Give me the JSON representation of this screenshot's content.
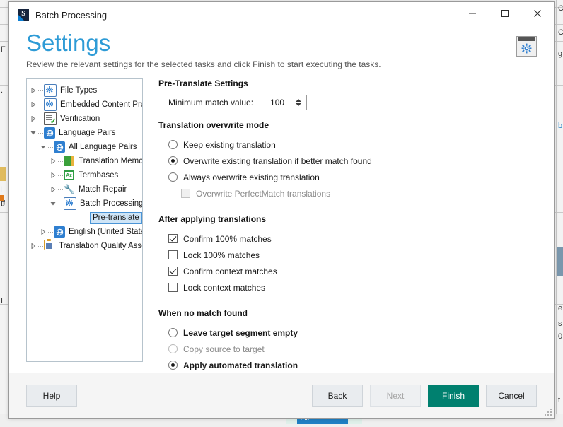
{
  "window": {
    "title": "Batch Processing",
    "app_icon": "trados-studio-icon",
    "icon_letter": "S",
    "minimize_label": "Minimize",
    "maximize_label": "Maximize",
    "close_label": "Close"
  },
  "header": {
    "title": "Settings",
    "subtitle": "Review the relevant settings for the selected tasks and click Finish to start executing the tasks.",
    "title_color": "#2e9bd6",
    "gear_button": "settings-gear"
  },
  "tree": {
    "items": [
      {
        "label": "File Types",
        "icon": "gear-box-icon",
        "indent": 0,
        "expander": "collapsed",
        "selected": false
      },
      {
        "label": "Embedded Content Proc",
        "icon": "gear-box-icon",
        "indent": 0,
        "expander": "collapsed",
        "selected": false
      },
      {
        "label": "Verification",
        "icon": "verification-doc-icon",
        "indent": 0,
        "expander": "collapsed",
        "selected": false
      },
      {
        "label": "Language Pairs",
        "icon": "language-globe-icon",
        "indent": 0,
        "expander": "expanded",
        "selected": false
      },
      {
        "label": "All Language Pairs",
        "icon": "language-globe-icon",
        "indent": 1,
        "expander": "expanded",
        "selected": false
      },
      {
        "label": "Translation Memo",
        "icon": "translation-memory-icon",
        "indent": 2,
        "expander": "collapsed",
        "selected": false
      },
      {
        "label": "Termbases",
        "icon": "termbase-icon",
        "indent": 2,
        "expander": "collapsed",
        "selected": false
      },
      {
        "label": "Match Repair",
        "icon": "wrench-icon",
        "indent": 2,
        "expander": "collapsed",
        "selected": false
      },
      {
        "label": "Batch Processing",
        "icon": "gear-box-icon",
        "indent": 2,
        "expander": "expanded",
        "selected": false
      },
      {
        "label": "Pre-translate Files",
        "icon": "none",
        "indent": 3,
        "expander": "none",
        "selected": true
      },
      {
        "label": "English (United States",
        "icon": "language-globe-icon",
        "indent": 1,
        "expander": "collapsed",
        "selected": false
      },
      {
        "label": "Translation Quality Assess",
        "icon": "clipboard-icon",
        "indent": 0,
        "expander": "collapsed",
        "selected": false
      }
    ]
  },
  "settings": {
    "pre_translate": {
      "title": "Pre-Translate Settings",
      "min_match_label": "Minimum match value:",
      "min_match_value": "100"
    },
    "overwrite_mode": {
      "title": "Translation overwrite mode",
      "options": [
        {
          "label": "Keep existing translation",
          "selected": false
        },
        {
          "label": "Overwrite existing translation if better match found",
          "selected": true
        },
        {
          "label": "Always overwrite existing translation",
          "selected": false
        }
      ],
      "sub_checkbox": {
        "label": "Overwrite PerfectMatch translations",
        "checked": false,
        "disabled": true
      }
    },
    "after_applying": {
      "title": "After applying translations",
      "checkboxes": [
        {
          "label": "Confirm 100% matches",
          "checked": true
        },
        {
          "label": "Lock 100% matches",
          "checked": false
        },
        {
          "label": "Confirm context matches",
          "checked": true
        },
        {
          "label": "Lock context matches",
          "checked": false
        }
      ]
    },
    "no_match": {
      "title": "When no match found",
      "options": [
        {
          "label": "Leave target segment empty",
          "selected": false,
          "emphasis": true
        },
        {
          "label": "Copy source to target",
          "selected": false,
          "emphasis": false
        },
        {
          "label": "Apply automated translation",
          "selected": true,
          "emphasis": true
        }
      ]
    }
  },
  "footer": {
    "help_label": "Help",
    "back_label": "Back",
    "next_label": "Next",
    "next_disabled": true,
    "finish_label": "Finish",
    "cancel_label": "Cancel",
    "finish_color": "#00806f"
  }
}
